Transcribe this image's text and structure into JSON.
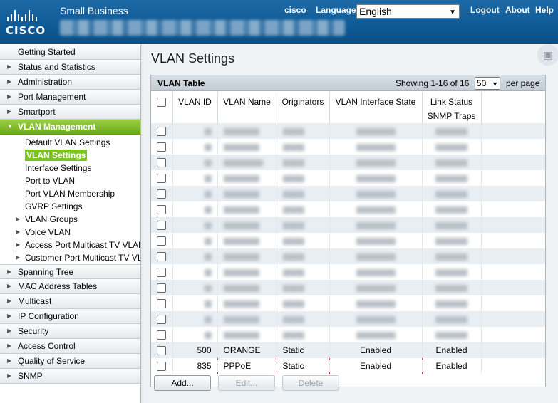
{
  "header": {
    "product": "Small Business",
    "brand": "cisco",
    "logo_text": "CISCO",
    "language_label": "Language:",
    "language_value": "English",
    "links": [
      "Logout",
      "About",
      "Help"
    ]
  },
  "sidebar": {
    "top_item": "Getting Started",
    "items_before": [
      "Status and Statistics",
      "Administration",
      "Port Management",
      "Smartport"
    ],
    "active_item": "VLAN Management",
    "subitems": [
      {
        "label": "Default VLAN Settings",
        "expandable": false
      },
      {
        "label": "VLAN Settings",
        "selected": true,
        "expandable": false
      },
      {
        "label": "Interface Settings",
        "expandable": false
      },
      {
        "label": "Port to VLAN",
        "expandable": false
      },
      {
        "label": "Port VLAN Membership",
        "expandable": false
      },
      {
        "label": "GVRP Settings",
        "expandable": false
      },
      {
        "label": "VLAN Groups",
        "expandable": true
      },
      {
        "label": "Voice VLAN",
        "expandable": true
      },
      {
        "label": "Access Port Multicast TV VLAN",
        "expandable": true
      },
      {
        "label": "Customer Port Multicast TV VLAN",
        "expandable": true
      }
    ],
    "items_after": [
      "Spanning Tree",
      "MAC Address Tables",
      "Multicast",
      "IP Configuration",
      "Security",
      "Access Control",
      "Quality of Service",
      "SNMP"
    ]
  },
  "main": {
    "title": "VLAN Settings",
    "table": {
      "title": "VLAN Table",
      "showing": "Showing 1-16 of 16",
      "per_page_value": "50",
      "per_page_label": "per page",
      "columns": [
        "VLAN ID",
        "VLAN Name",
        "Originators",
        "VLAN Interface State",
        "Link Status",
        "SNMP Traps"
      ],
      "blurred_row_count": 14,
      "rows": [
        {
          "id": "500",
          "name": "ORANGE",
          "originators": "Static",
          "interface_state": "Enabled",
          "snmp_traps": "Enabled"
        },
        {
          "id": "835",
          "name": "PPPoE",
          "originators": "Static",
          "interface_state": "Enabled",
          "snmp_traps": "Enabled",
          "highlighted": true
        }
      ]
    },
    "buttons": {
      "add": "Add...",
      "edit": "Edit...",
      "delete": "Delete"
    }
  },
  "colors": {
    "header_blue": "#0d5a97",
    "active_green": "#7cc221",
    "highlight_red": "#e0202a"
  }
}
